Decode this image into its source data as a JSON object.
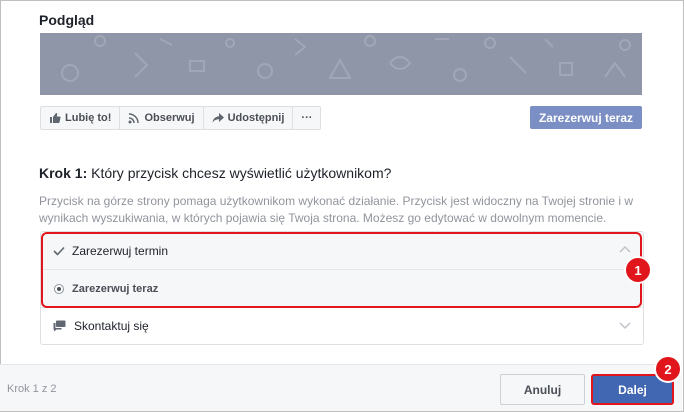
{
  "preview": {
    "title": "Podgląd"
  },
  "page_actions": {
    "like_label": "Lubię to!",
    "follow_label": "Obserwuj",
    "share_label": "Udostępnij",
    "more_label": "···",
    "book_now_label": "Zarezerwuj teraz"
  },
  "step": {
    "prefix": "Krok 1:",
    "question": " Który przycisk chcesz wyświetlić użytkownikom?",
    "description": "Przycisk na górze strony pomaga użytkownikom wykonać działanie. Przycisk jest widoczny na Twojej stronie i w wynikach wyszukiwania, w których pojawia się Twoja strona. Możesz go edytować w dowolnym momencie."
  },
  "options": {
    "booking": {
      "label": "Zarezerwuj termin",
      "selected_sub": "Zarezerwuj teraz"
    },
    "contact": {
      "label": "Skontaktuj się"
    }
  },
  "annotations": {
    "badge1": "1",
    "badge2": "2",
    "highlight_color": "#e0161c"
  },
  "footer": {
    "step_counter": "Krok 1 z 2",
    "cancel_label": "Anuluj",
    "next_label": "Dalej"
  },
  "colors": {
    "primary": "#4267b2",
    "book_button": "#7b8fc4",
    "cover": "#8f96a8"
  }
}
